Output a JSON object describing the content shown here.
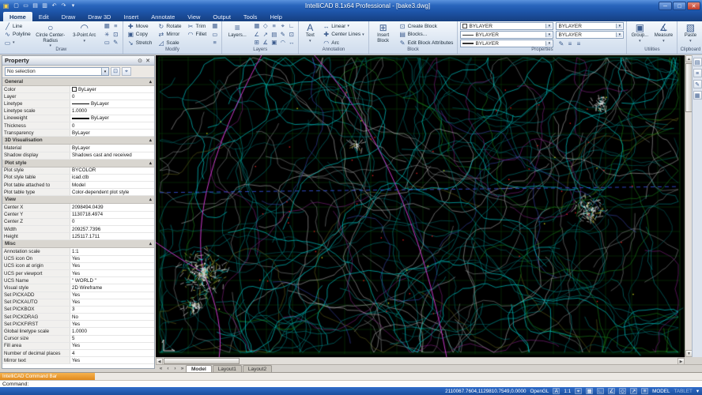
{
  "window": {
    "title": "IntelliCAD 8.1x64 Professional - [bake3.dwg]",
    "qat": [
      "new",
      "open",
      "save",
      "print",
      "undo",
      "redo",
      "caret"
    ]
  },
  "menu": {
    "tabs": [
      {
        "label": "Home",
        "active": true
      },
      {
        "label": "Edit"
      },
      {
        "label": "Draw"
      },
      {
        "label": "Draw 3D"
      },
      {
        "label": "Insert"
      },
      {
        "label": "Annotate"
      },
      {
        "label": "View"
      },
      {
        "label": "Output"
      },
      {
        "label": "Tools"
      },
      {
        "label": "Help"
      }
    ]
  },
  "ribbon": {
    "draw": {
      "label": "Draw",
      "line": "Line",
      "polyline": "Polyline",
      "circle": "Circle Center-Radius",
      "arc": "3-Point Arc",
      "extra": [
        "array",
        "offset",
        "explode",
        "createblock",
        "erase",
        "editattr"
      ]
    },
    "modify": {
      "label": "Modify",
      "col1": [
        "Move",
        "Copy",
        "Stretch"
      ],
      "col2": [
        "Rotate",
        "Mirror",
        "Scale"
      ],
      "col3": [
        "Trim",
        "Fillet"
      ],
      "extra": [
        "array",
        "erase",
        "offset"
      ]
    },
    "layers": {
      "label": "Layers",
      "big": "Layers...",
      "tools": [
        "grid",
        "esnap",
        "lwt",
        "snap",
        "ortho",
        "polar",
        "etrack",
        "blocks",
        "editattr",
        "createblock",
        "insertblock",
        "measure",
        "group",
        "arcdim",
        "linear"
      ]
    },
    "annotation": {
      "label": "Annotation",
      "big": "Text",
      "items": [
        "Linear",
        "Center Lines",
        "Arc"
      ]
    },
    "block": {
      "label": "Block",
      "big": "Insert Block",
      "items": [
        "Create Block",
        "Blocks...",
        "Edit Block Attributes"
      ]
    },
    "properties": {
      "label": "Properties",
      "combos": [
        "BYLAYER",
        "BYLAYER",
        "BYLAYER",
        "BYLAYER",
        "BYLAYER"
      ]
    },
    "utilities": {
      "label": "Utilities",
      "items": [
        "Group...",
        "Measure"
      ]
    },
    "clipboard": {
      "label": "Clipboard",
      "big": "Paste"
    }
  },
  "right_dock": {
    "icons": [
      "blocks",
      "layers_ic",
      "editattr",
      "grid"
    ]
  },
  "property_panel": {
    "title": "Property",
    "selector": "No selection",
    "sections": [
      {
        "name": "General",
        "rows": [
          {
            "label": "Color",
            "value": "ByLayer",
            "deco": "swatch"
          },
          {
            "label": "Layer",
            "value": "0"
          },
          {
            "label": "Linetype",
            "value": "ByLayer",
            "deco": "line"
          },
          {
            "label": "Linetype scale",
            "value": "1.0000"
          },
          {
            "label": "Lineweight",
            "value": "ByLayer",
            "deco": "lwline"
          },
          {
            "label": "Thickness",
            "value": "0"
          },
          {
            "label": "Transparency",
            "value": "ByLayer"
          }
        ]
      },
      {
        "name": "3D Visualisation",
        "rows": [
          {
            "label": "Material",
            "value": "ByLayer"
          },
          {
            "label": "Shadow display",
            "value": "Shadows cast and received"
          }
        ]
      },
      {
        "name": "Plot style",
        "rows": [
          {
            "label": "Plot style",
            "value": "BYCOLOR"
          },
          {
            "label": "Plot style table",
            "value": "icad.ctb"
          },
          {
            "label": "Plot table attached to",
            "value": "Model"
          },
          {
            "label": "Plot table type",
            "value": "Color-dependent plot style"
          }
        ]
      },
      {
        "name": "View",
        "rows": [
          {
            "label": "Center X",
            "value": "2098494.0439"
          },
          {
            "label": "Center Y",
            "value": "1130718.4974"
          },
          {
            "label": "Center Z",
            "value": "0"
          },
          {
            "label": "Width",
            "value": "209257.7396"
          },
          {
            "label": "Height",
            "value": "125117.1711"
          }
        ]
      },
      {
        "name": "Misc",
        "rows": [
          {
            "label": "Annotation scale",
            "value": "1:1"
          },
          {
            "label": "UCS icon On",
            "value": "Yes"
          },
          {
            "label": "UCS icon at origin",
            "value": "Yes"
          },
          {
            "label": "UCS per viewport",
            "value": "Yes"
          },
          {
            "label": "UCS Name",
            "value": "\" WORLD \""
          },
          {
            "label": "Visual style",
            "value": "2D Wireframe"
          },
          {
            "label": "Set PICKADD",
            "value": "Yes"
          },
          {
            "label": "Set PICKAUTO",
            "value": "Yes"
          },
          {
            "label": "Set PICKBOX",
            "value": "3"
          },
          {
            "label": "Set PICKDRAG",
            "value": "No"
          },
          {
            "label": "Set PICKFIRST",
            "value": "Yes"
          },
          {
            "label": "Global linetype scale",
            "value": "1.0000"
          },
          {
            "label": "Cursor size",
            "value": "5"
          },
          {
            "label": "Fill area",
            "value": "Yes"
          },
          {
            "label": "Number of decimal places",
            "value": "4"
          },
          {
            "label": "Mirror text",
            "value": "Yes"
          }
        ]
      }
    ]
  },
  "drawing": {
    "tabs": [
      {
        "label": "Model",
        "active": true
      },
      {
        "label": "Layout1"
      },
      {
        "label": "Layout2"
      }
    ],
    "colors": {
      "background": "#000000",
      "grid": "#0b4d0b",
      "contour": "#00a0a0",
      "road": "#c838c8",
      "highlight": "#e8e8e8",
      "marker": "#e02020",
      "section_line": "#3858e8"
    }
  },
  "command_bar": {
    "title": "IntelliCAD Command Bar",
    "prompt": "Command:"
  },
  "status_bar": {
    "coordinates": "2110067.7604,1129810.7549,0.0000",
    "renderer": "OpenGL",
    "annotation_scale": "1:1",
    "mode": "MODEL",
    "tablet": "TABLET"
  },
  "icons": {
    "app": "▣",
    "new": "▢",
    "open": "▭",
    "save": "▤",
    "print": "▥",
    "undo": "↶",
    "redo": "↷",
    "caret": "▾",
    "caretup": "▴",
    "minimize": "─",
    "maximize": "□",
    "close": "✕",
    "pin": "⊙",
    "line": "╱",
    "polyline": "∿",
    "circle": "○",
    "arc": "◠",
    "move": "✚",
    "copy": "▣",
    "stretch": "↘",
    "rotate": "↻",
    "mirror": "⇄",
    "scale": "◿",
    "trim": "✂",
    "fillet": "◠",
    "array": "▦",
    "erase": "▭",
    "explode": "✳",
    "offset": "≡",
    "layers_ic": "≡",
    "text": "A",
    "linear": "↔",
    "centerlines": "✚",
    "arcdim": "◠",
    "insertblock": "⊞",
    "createblock": "⊡",
    "blocks": "▤",
    "editattr": "✎",
    "group": "▣",
    "measure": "∡",
    "paste": "▧",
    "snap": "⌖",
    "grid": "▦",
    "ortho": "∟",
    "polar": "∠",
    "esnap": "◇",
    "etrack": "↗",
    "lwt": "≡",
    "annot": "A",
    "quickselect": "⌖",
    "pickadd": "⊡",
    "navfirst": "«",
    "navprev": "‹",
    "navnext": "›",
    "navlast": "»",
    "up": "▲",
    "down": "▼",
    "left": "◀",
    "right": "▶"
  }
}
